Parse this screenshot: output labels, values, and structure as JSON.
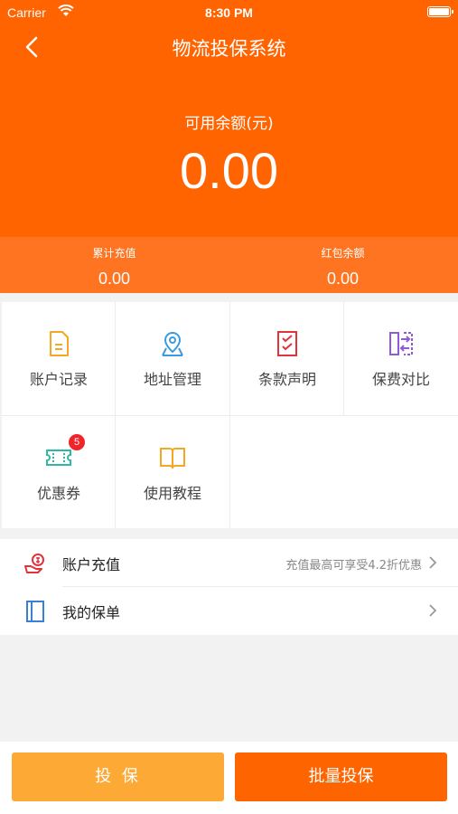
{
  "status_bar": {
    "carrier": "Carrier",
    "time": "8:30 PM"
  },
  "header": {
    "title": "物流投保系统",
    "balance_label": "可用余额(元)",
    "balance_value": "0.00",
    "background_color": "#ff6400"
  },
  "stats": {
    "recharge_label": "累计充值",
    "recharge_value": "0.00",
    "redpacket_label": "红包余额",
    "redpacket_value": "0.00"
  },
  "grid": {
    "items": [
      {
        "label": "账户记录",
        "icon": "document-icon",
        "color": "#f5a623"
      },
      {
        "label": "地址管理",
        "icon": "location-pin-icon",
        "color": "#3a9be0"
      },
      {
        "label": "条款声明",
        "icon": "checklist-icon",
        "color": "#e2333a"
      },
      {
        "label": "保费对比",
        "icon": "compare-icon",
        "color": "#8e5ad6"
      },
      {
        "label": "优惠券",
        "icon": "coupon-icon",
        "color": "#2fb8a3",
        "badge": "5"
      },
      {
        "label": "使用教程",
        "icon": "book-icon",
        "color": "#f5a623"
      }
    ]
  },
  "list": {
    "recharge_label": "账户充值",
    "recharge_hint": "充值最高可享受4.2折优惠",
    "recharge_icon": "money-hand-icon",
    "policy_label": "我的保单",
    "policy_icon": "notebook-icon"
  },
  "buttons": {
    "insure": "投 保",
    "batch_insure": "批量投保"
  }
}
